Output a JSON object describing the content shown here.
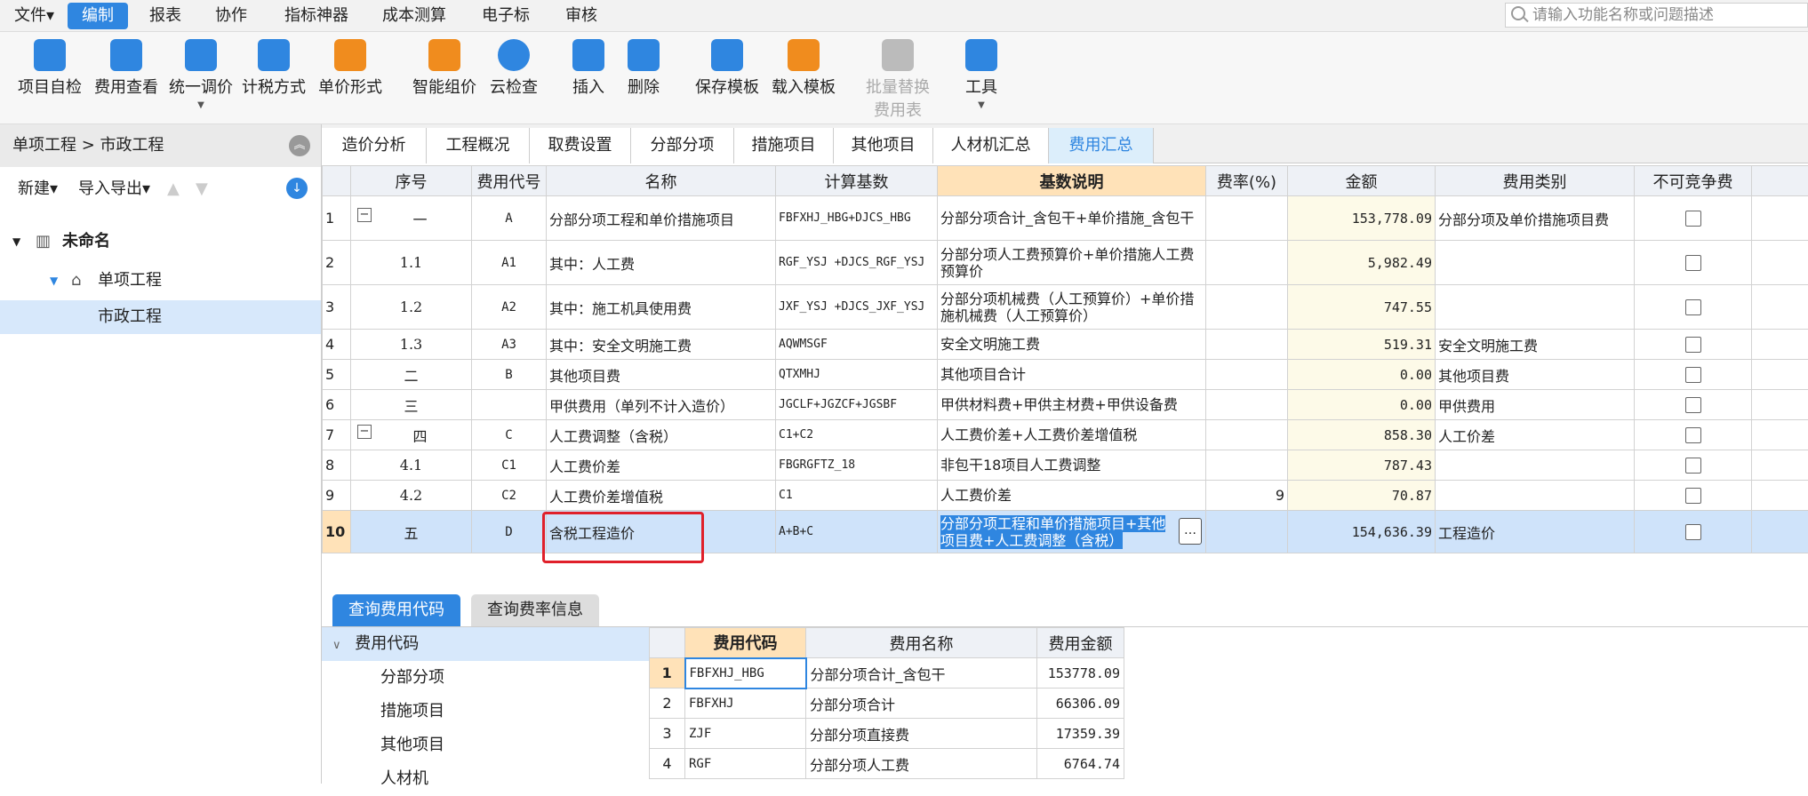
{
  "menu": [
    "文件▾",
    "编制",
    "报表",
    "协作",
    "指标神器",
    "成本测算",
    "电子标",
    "审核"
  ],
  "search_placeholder": "请输入功能名称或问题描述",
  "toolbar": [
    {
      "label": "项目自检",
      "icon": "check-doc-icon",
      "color": "#2f86e0"
    },
    {
      "label": "费用查看",
      "icon": "fee-view-icon",
      "color": "#2f86e0"
    },
    {
      "label": "统一调价",
      "icon": "adjust-price-icon",
      "color": "#2f86e0"
    },
    {
      "label": "计税方式",
      "icon": "tax-icon",
      "color": "#2f86e0"
    },
    {
      "label": "单价形式",
      "icon": "unit-price-icon",
      "color": "#f08c1e"
    },
    {
      "label": "智能组价",
      "icon": "smart-price-icon",
      "color": "#f08c1e"
    },
    {
      "label": "云检查",
      "icon": "cloud-check-icon",
      "color": "#2f86e0"
    },
    {
      "label": "插入",
      "icon": "insert-icon",
      "color": "#2f86e0"
    },
    {
      "label": "删除",
      "icon": "delete-icon",
      "color": "#2f86e0"
    },
    {
      "label": "保存模板",
      "icon": "save-template-icon",
      "color": "#2f86e0"
    },
    {
      "label": "载入模板",
      "icon": "load-template-icon",
      "color": "#f08c1e"
    },
    {
      "label": "批量替换",
      "label2": "费用表",
      "icon": "batch-replace-icon",
      "color": "#bbbbbb"
    },
    {
      "label": "工具",
      "icon": "tools-icon",
      "color": "#2f86e0"
    }
  ],
  "breadcrumb": "单项工程 > 市政工程",
  "left_tools": {
    "new": "新建▾",
    "import": "导入导出▾"
  },
  "tree": [
    {
      "label": "未命名",
      "level": 0
    },
    {
      "label": "单项工程",
      "level": 1
    },
    {
      "label": "市政工程",
      "level": 2
    }
  ],
  "tabs": [
    "造价分析",
    "工程概况",
    "取费设置",
    "分部分项",
    "措施项目",
    "其他项目",
    "人材机汇总",
    "费用汇总"
  ],
  "grid_headers": [
    "",
    "序号",
    "费用代号",
    "名称",
    "计算基数",
    "基数说明",
    "费率(%)",
    "金额",
    "费用类别",
    "不可竞争费"
  ],
  "rows": [
    {
      "idx": "1",
      "seq": "一",
      "code": "A",
      "name": "分部分项工程和单价措施项目",
      "base": "FBFXHJ_HBG+DJCS_HBG",
      "desc": "分部分项合计_含包干+单价措施_含包干",
      "rate": "",
      "amount": "153,778.09",
      "type": "分部分项及单价措施项目费"
    },
    {
      "idx": "2",
      "seq": "1.1",
      "code": "A1",
      "name": "其中：人工费",
      "base": "RGF_YSJ +DJCS_RGF_YSJ",
      "desc": "分部分项人工费预算价+单价措施人工费预算价",
      "rate": "",
      "amount": "5,982.49",
      "type": ""
    },
    {
      "idx": "3",
      "seq": "1.2",
      "code": "A2",
      "name": "其中：施工机具使用费",
      "base": "JXF_YSJ +DJCS_JXF_YSJ",
      "desc": "分部分项机械费（人工预算价）+单价措施机械费（人工预算价）",
      "rate": "",
      "amount": "747.55",
      "type": ""
    },
    {
      "idx": "4",
      "seq": "1.3",
      "code": "A3",
      "name": "其中：安全文明施工费",
      "base": "AQWMSGF",
      "desc": "安全文明施工费",
      "rate": "",
      "amount": "519.31",
      "type": "安全文明施工费"
    },
    {
      "idx": "5",
      "seq": "二",
      "code": "B",
      "name": "其他项目费",
      "base": "QTXMHJ",
      "desc": "其他项目合计",
      "rate": "",
      "amount": "0.00",
      "type": "其他项目费"
    },
    {
      "idx": "6",
      "seq": "三",
      "code": "",
      "name": "甲供费用（单列不计入造价）",
      "base": "JGCLF+JGZCF+JGSBF",
      "desc": "甲供材料费+甲供主材费+甲供设备费",
      "rate": "",
      "amount": "0.00",
      "type": "甲供费用"
    },
    {
      "idx": "7",
      "seq": "四",
      "code": "C",
      "name": "人工费调整（含税）",
      "base": "C1+C2",
      "desc": "人工费价差+人工费价差增值税",
      "rate": "",
      "amount": "858.30",
      "type": "人工价差"
    },
    {
      "idx": "8",
      "seq": "4.1",
      "code": "C1",
      "name": "人工费价差",
      "base": "FBGRGFTZ_18",
      "desc": "非包干18项目人工费调整",
      "rate": "",
      "amount": "787.43",
      "type": ""
    },
    {
      "idx": "9",
      "seq": "4.2",
      "code": "C2",
      "name": "人工费价差增值税",
      "base": "C1",
      "desc": "人工费价差",
      "rate": "9",
      "amount": "70.87",
      "type": ""
    },
    {
      "idx": "10",
      "seq": "五",
      "code": "D",
      "name": "含税工程造价",
      "base": "A+B+C",
      "desc": "分部分项工程和单价措施项目+其他项目费+人工费调整（含税）",
      "rate": "",
      "amount": "154,636.39",
      "type": "工程造价"
    }
  ],
  "bottom_tabs": [
    "查询费用代码",
    "查询费率信息"
  ],
  "code_tree": {
    "root": "费用代码",
    "children": [
      "分部分项",
      "措施项目",
      "其他项目",
      "人材机"
    ]
  },
  "sub_headers": [
    "",
    "费用代码",
    "费用名称",
    "费用金额"
  ],
  "sub_rows": [
    {
      "idx": "1",
      "code": "FBFXHJ_HBG",
      "name": "分部分项合计_含包干",
      "amount": "153778.09"
    },
    {
      "idx": "2",
      "code": "FBFXHJ",
      "name": "分部分项合计",
      "amount": "66306.09"
    },
    {
      "idx": "3",
      "code": "ZJF",
      "name": "分部分项直接费",
      "amount": "17359.39"
    },
    {
      "idx": "4",
      "code": "RGF",
      "name": "分部分项人工费",
      "amount": "6764.74"
    }
  ]
}
